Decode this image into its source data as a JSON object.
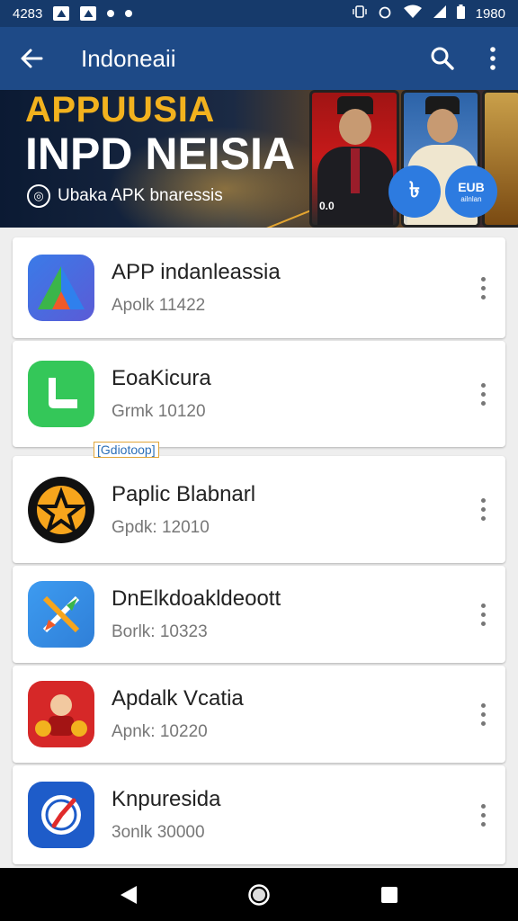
{
  "status_bar": {
    "time_left": "4283",
    "time_right": "1980"
  },
  "app_bar": {
    "title": "Indoneaii"
  },
  "banner": {
    "line1": "APPUUSIA",
    "line2": "INPD NEISIA",
    "subtitle": "Ubaka APK bnaressis",
    "phone_label": "0.0",
    "badge_left": "৳",
    "badge_right_top": "EUB",
    "badge_right_bottom": "ailnlan"
  },
  "group_tag": "[Gdiotoop]",
  "apps": [
    {
      "name": "APP  indanleassia",
      "sub": "Apolk 11422",
      "icon": "triangle-logo-icon",
      "colors": [
        "#2f80ed",
        "#3bb54a",
        "#f05a28"
      ]
    },
    {
      "name": "EoaKicura",
      "sub": "Grmk 10120",
      "icon": "phone-handset-icon",
      "colors": [
        "#34c759"
      ]
    },
    {
      "name": "Paplic Blabnarl",
      "sub": "Gpdk: 12010",
      "icon": "star-badge-icon",
      "colors": [
        "#f7a51c"
      ]
    },
    {
      "name": "DnElkdoakldeoott",
      "sub": "Borlk: 10323",
      "icon": "crossed-arrows-icon",
      "colors": [
        "#3d9bf0"
      ]
    },
    {
      "name": "Apdalk Vcatia",
      "sub": "Apnk: 10220",
      "icon": "cartoon-character-icon",
      "colors": [
        "#d62828"
      ]
    },
    {
      "name": "Knpuresida",
      "sub": "3onlk 30000",
      "icon": "compass-icon",
      "colors": [
        "#1e5cc9"
      ]
    }
  ]
}
